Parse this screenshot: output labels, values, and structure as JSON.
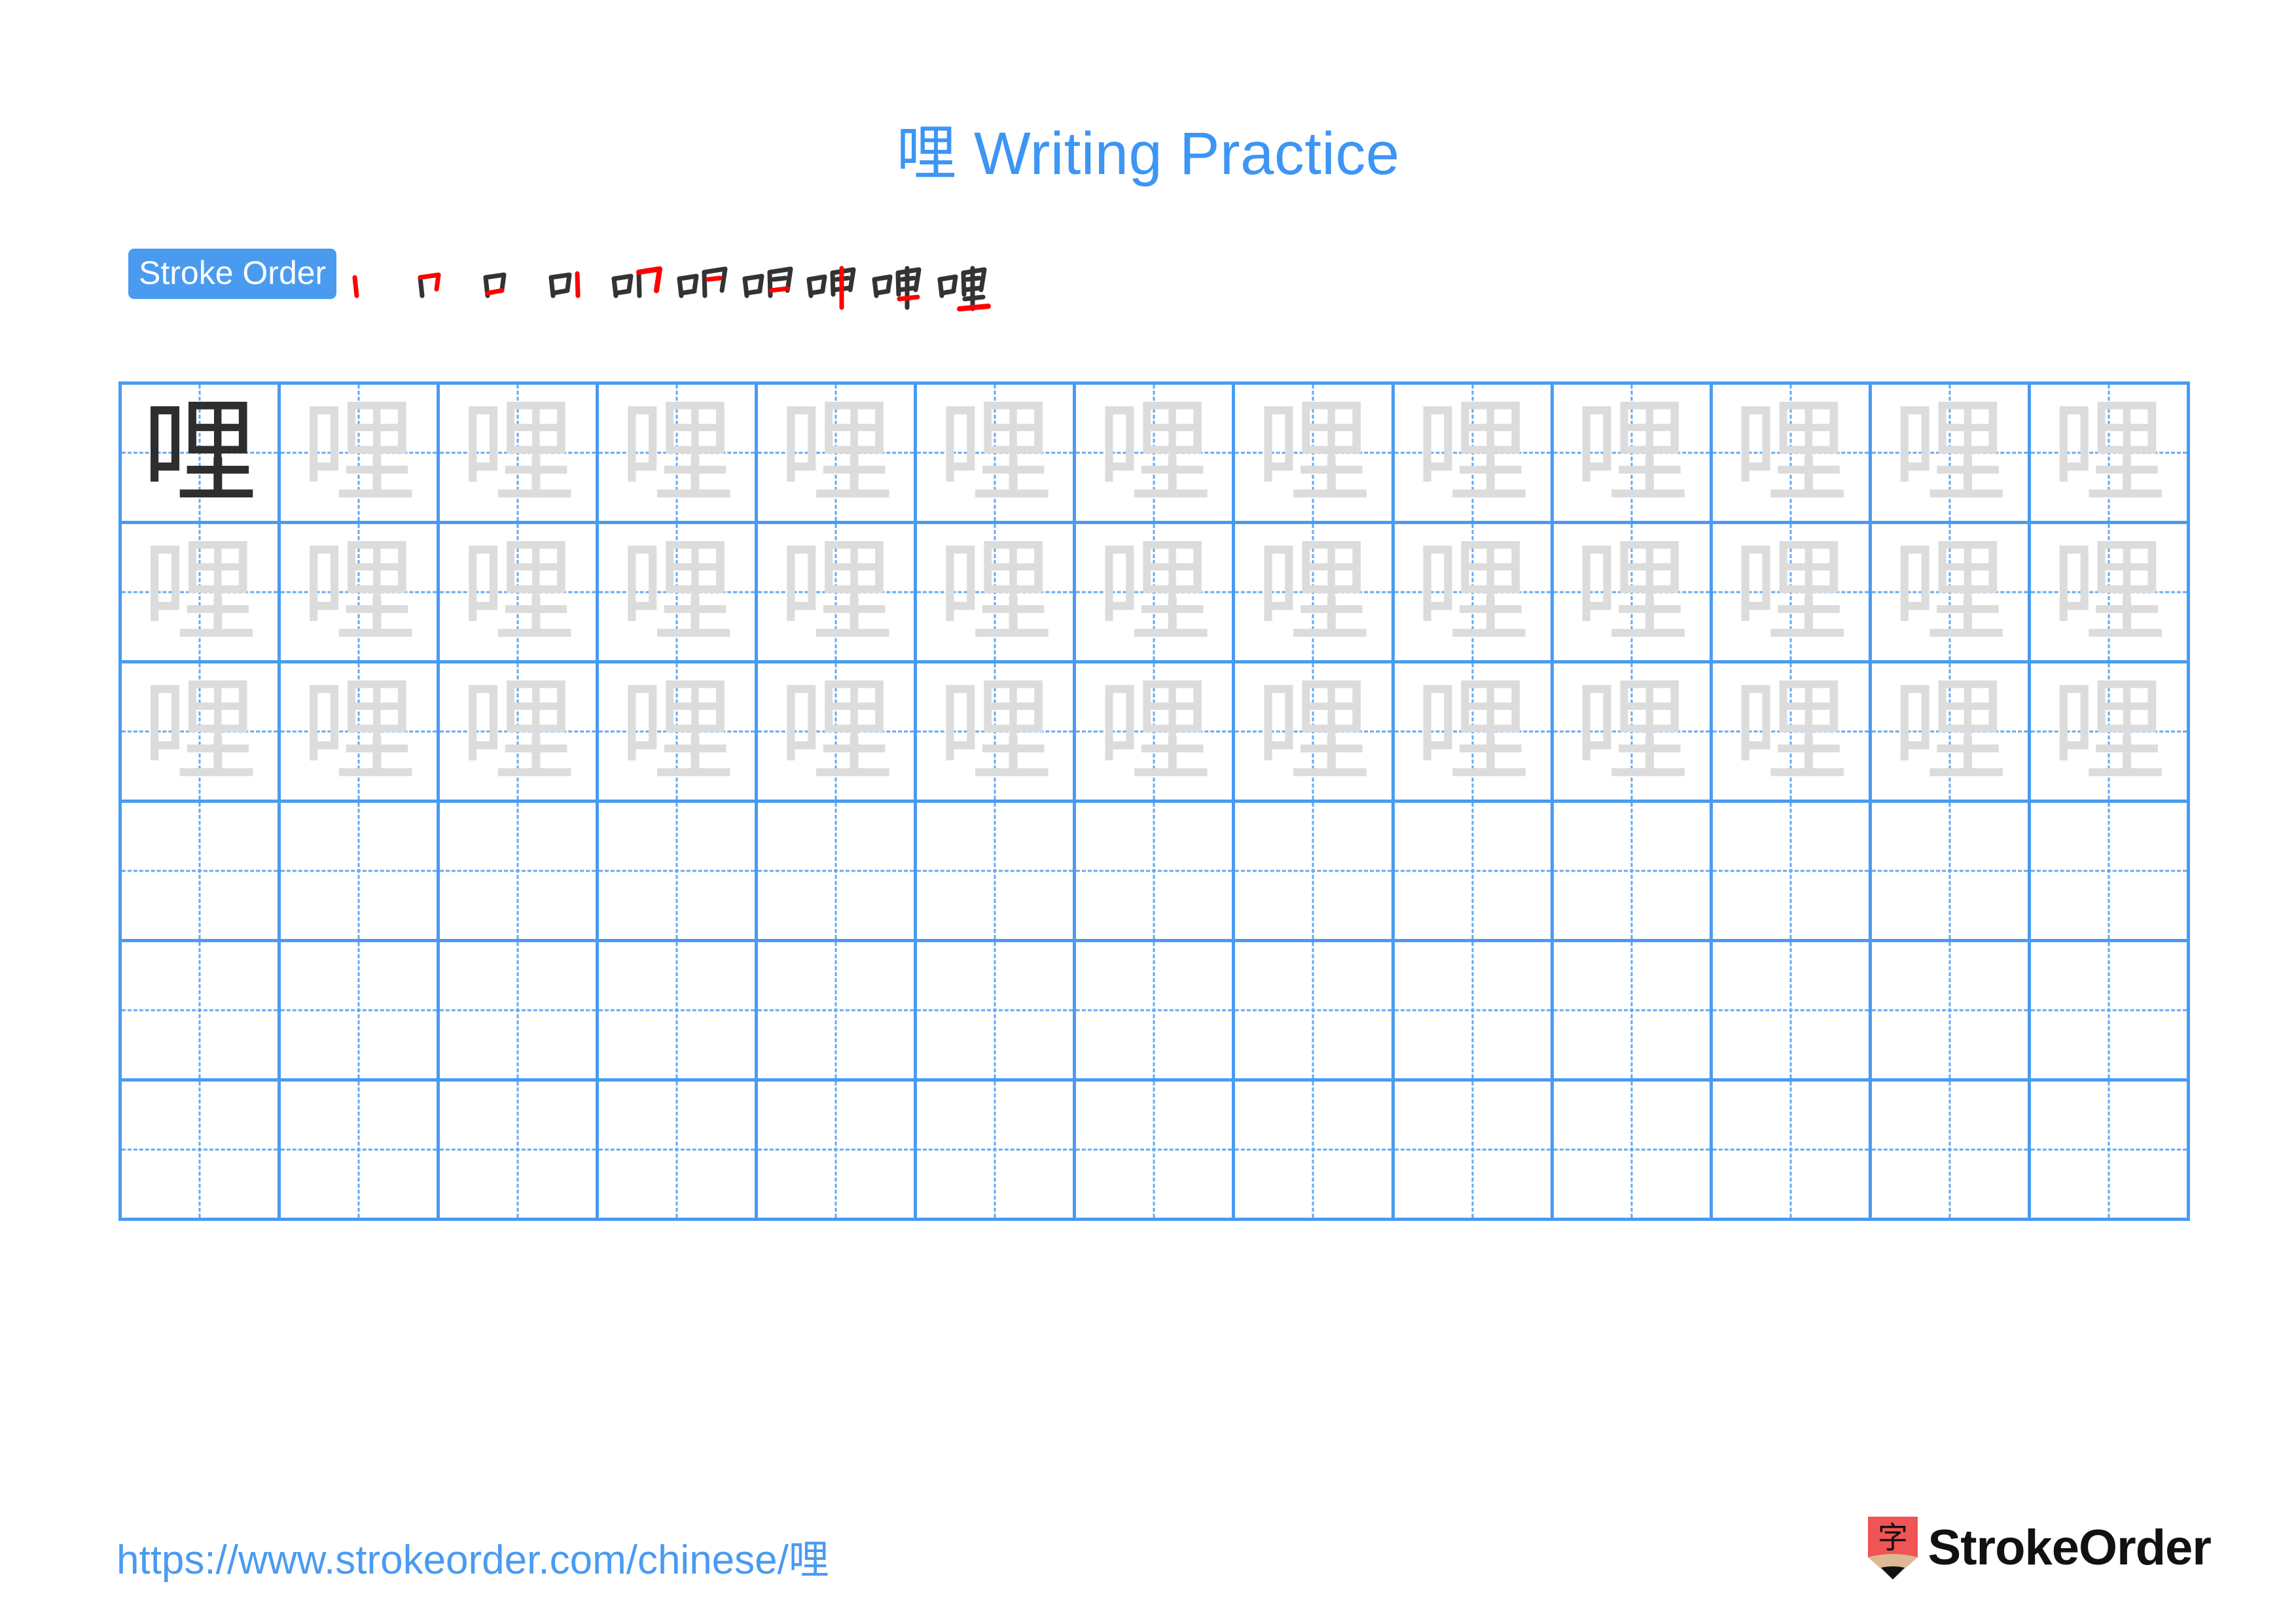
{
  "title": {
    "character": "哩",
    "suffix": " Writing Practice",
    "color": "#3d95f5"
  },
  "stroke_order": {
    "badge_label": "Stroke Order",
    "badge_bg": "#4a9bf0",
    "badge_text_color": "#ffffff",
    "new_stroke_color": "#ff0000",
    "prev_stroke_color": "#333333",
    "step_count": 10,
    "steps": [
      {
        "index": 1,
        "strokes_shown": 1,
        "new_stroke": "丨 (left vertical of 口)"
      },
      {
        "index": 2,
        "strokes_shown": 2,
        "new_stroke": "𠃍 (horizontal-turn of 口)"
      },
      {
        "index": 3,
        "strokes_shown": 3,
        "new_stroke": "一 (bottom of 口)"
      },
      {
        "index": 4,
        "strokes_shown": 4,
        "new_stroke": "丨 (left vertical of 里)"
      },
      {
        "index": 5,
        "strokes_shown": 5,
        "new_stroke": "𠃌 (horizontal-turn of 田)"
      },
      {
        "index": 6,
        "strokes_shown": 6,
        "new_stroke": "一 (upper inner horizontal)"
      },
      {
        "index": 7,
        "strokes_shown": 7,
        "new_stroke": "一 (bottom of 田)"
      },
      {
        "index": 8,
        "strokes_shown": 8,
        "new_stroke": "丨 (long vertical)"
      },
      {
        "index": 9,
        "strokes_shown": 9,
        "new_stroke": "一 (middle horizontal)"
      },
      {
        "index": 10,
        "strokes_shown": 10,
        "new_stroke": "一 (bottom horizontal)"
      }
    ]
  },
  "grid": {
    "columns": 13,
    "rows": 6,
    "filled_rows": 3,
    "empty_rows": 3,
    "model_cell": {
      "row": 1,
      "column": 1,
      "character": "哩",
      "color": "#2e2e2e"
    },
    "trace_character": "哩",
    "trace_color": "#dcdcdc",
    "line_color": "#4a9bf0",
    "guide_color": "#63aaf2"
  },
  "footer": {
    "url": "https://www.strokeorder.com/chinese/哩",
    "url_color": "#4a9bf0",
    "logo_text": "StrokeOrder",
    "logo_glyph": "字",
    "logo_body_color": "#f05454",
    "logo_wood_color": "#dcb894",
    "logo_tip_color": "#111111"
  }
}
